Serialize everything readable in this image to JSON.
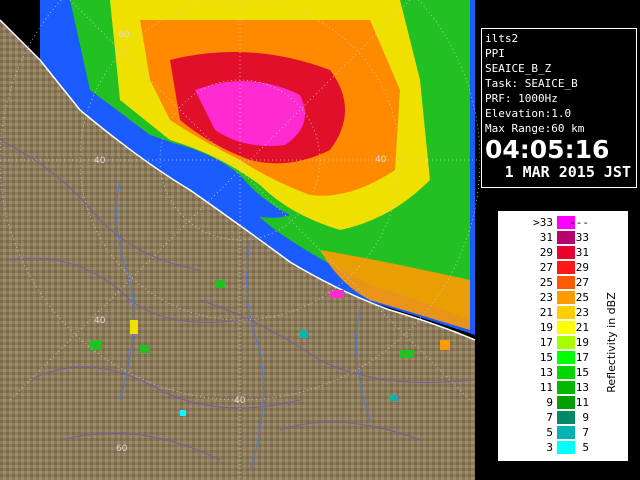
{
  "info": {
    "station": "ilts2",
    "scan_type": "PPI",
    "product": "SEAICE_B_Z",
    "task": "Task: SEAICE_B",
    "prf": "PRF: 1000Hz",
    "elevation": "Elevation:1.0",
    "max_range": "Max Range:60 km",
    "time": "04:05:16",
    "date": "1 MAR 2015 JST"
  },
  "legend": {
    "title": "Reflectivity in dBZ",
    "rows": [
      {
        "left": ">33",
        "right": "---",
        "color": "#ff00ff"
      },
      {
        "left": "31",
        "right": "33",
        "color": "#b8006e"
      },
      {
        "left": "29",
        "right": "31",
        "color": "#e8002e"
      },
      {
        "left": "27",
        "right": "29",
        "color": "#ff1818"
      },
      {
        "left": "25",
        "right": "27",
        "color": "#ff5a00"
      },
      {
        "left": "23",
        "right": "25",
        "color": "#ff9a00"
      },
      {
        "left": "21",
        "right": "23",
        "color": "#ffd000"
      },
      {
        "left": "19",
        "right": "21",
        "color": "#ffff00"
      },
      {
        "left": "17",
        "right": "19",
        "color": "#a8ff00"
      },
      {
        "left": "15",
        "right": "17",
        "color": "#00ff00"
      },
      {
        "left": "13",
        "right": "15",
        "color": "#00d800"
      },
      {
        "left": "11",
        "right": "13",
        "color": "#00b800"
      },
      {
        "left": "9",
        "right": "11",
        "color": "#00a000"
      },
      {
        "left": "7",
        "right": "9",
        "color": "#008a6a"
      },
      {
        "left": "5",
        "right": "7",
        "color": "#00b4b4"
      },
      {
        "left": "3",
        "right": "5",
        "color": "#00ffff"
      }
    ]
  },
  "range_labels": [
    "60",
    "40",
    "40",
    "40",
    "40",
    "60"
  ],
  "colors": {
    "land": "#8c7a5a",
    "sea": "#0050ff",
    "contour": "#7a5aa0",
    "river": "#4a7ad8"
  }
}
